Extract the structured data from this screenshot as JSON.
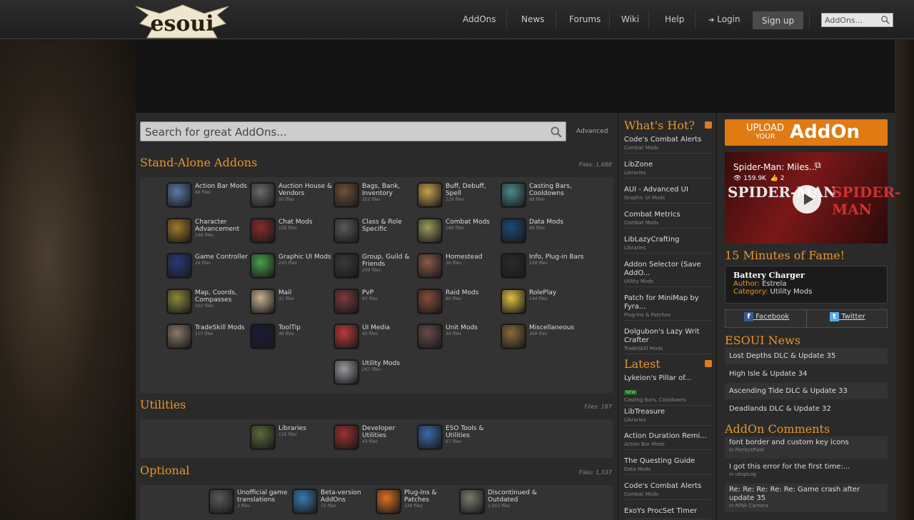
{
  "nav": {
    "logo_text": "esoui",
    "links": [
      "AddOns",
      "News",
      "Forums",
      "Wiki",
      "Help"
    ],
    "login": "Login",
    "signup": "Sign up",
    "search_placeholder": "AddOns..."
  },
  "search": {
    "placeholder": "Search for great AddOns...",
    "advanced": "Advanced"
  },
  "sections": {
    "standalone": {
      "title": "Stand-Alone Addons",
      "files": "Files: 1,688",
      "cats": [
        {
          "name": "Action Bar Mods",
          "count": "66 files",
          "color": "#5a7aa8"
        },
        {
          "name": "Auction House & Vendors",
          "count": "50 files",
          "color": "#6b6b6b"
        },
        {
          "name": "Bags, Bank, Inventory",
          "count": "315 files",
          "color": "#6e5238"
        },
        {
          "name": "Buff, Debuff, Spell",
          "count": "118 files",
          "color": "#c9a24a"
        },
        {
          "name": "Casting Bars, Cooldowns",
          "count": "68 files",
          "color": "#4a8a8a"
        },
        {
          "name": "Character Advancement",
          "count": "146 files",
          "color": "#a07a2a"
        },
        {
          "name": "Chat Mods",
          "count": "128 files",
          "color": "#8a2a2a"
        },
        {
          "name": "Class & Role Specific",
          "count": "",
          "color": "#5a5a5a"
        },
        {
          "name": "Combat Mods",
          "count": "168 files",
          "color": "#9a9a5a"
        },
        {
          "name": "Data Mods",
          "count": "88 files",
          "color": "#1a4a7a"
        },
        {
          "name": "Game Controller",
          "count": "16 files",
          "color": "#2a3a7a"
        },
        {
          "name": "Graphic UI Mods",
          "count": "243 files",
          "color": "#4aa04a"
        },
        {
          "name": "Group, Guild & Friends",
          "count": "209 files",
          "color": "#3a3a3a"
        },
        {
          "name": "Homestead",
          "count": "39 files",
          "color": "#8a5a4a"
        },
        {
          "name": "Info, Plug-in Bars",
          "count": "159 files",
          "color": "#2a2a2a"
        },
        {
          "name": "Map, Coords, Compasses",
          "count": "102 files",
          "color": "#8a8a3a"
        },
        {
          "name": "Mail",
          "count": "31 files",
          "color": "#c8b090"
        },
        {
          "name": "PvP",
          "count": "93 files",
          "color": "#7a3a3a"
        },
        {
          "name": "Raid Mods",
          "count": "80 files",
          "color": "#8a4a3a"
        },
        {
          "name": "RolePlay",
          "count": "144 files",
          "color": "#e0c040"
        },
        {
          "name": "TradeSkill Mods",
          "count": "115 files",
          "color": "#8a7a6a"
        },
        {
          "name": "ToolTip",
          "count": "48 files",
          "color": "#1a1a3a"
        },
        {
          "name": "UI Media",
          "count": "45 files",
          "color": "#c03a3a"
        },
        {
          "name": "Unit Mods",
          "count": "34 files",
          "color": "#6a4a4a"
        },
        {
          "name": "Miscellaneous",
          "count": "309 files",
          "color": "#8a6a3a"
        },
        {
          "name": "Utility Mods",
          "count": "267 files",
          "color": "#9a9aa0"
        }
      ]
    },
    "utilities": {
      "title": "Utilities",
      "files": "Files: 187",
      "cats": [
        {
          "name": "Libraries",
          "count": "116 files",
          "color": "#5a6a3a"
        },
        {
          "name": "Developer Utilities",
          "count": "43 files",
          "color": "#a03030"
        },
        {
          "name": "ESO Tools & Utilities",
          "count": "67 files",
          "color": "#3a6aa8"
        }
      ]
    },
    "optional": {
      "title": "Optional",
      "files": "Files: 1,337",
      "cats": [
        {
          "name": "Unofficial game translations",
          "count": "3 files",
          "color": "#5a5a5a"
        },
        {
          "name": "Beta-version AddOns",
          "count": "71 files",
          "color": "#3a7ab0"
        },
        {
          "name": "Plug-Ins & Patches",
          "count": "339 files",
          "color": "#e07020"
        },
        {
          "name": "Discontinued & Outdated",
          "count": "1,015 files",
          "color": "#7a7a6a"
        }
      ]
    }
  },
  "hot": {
    "title": "What's Hot?",
    "items": [
      {
        "name": "Code's Combat Alerts",
        "cat": "Combat Mods"
      },
      {
        "name": "LibZone",
        "cat": "Libraries"
      },
      {
        "name": "AUI - Advanced UI",
        "cat": "Graphic UI Mods"
      },
      {
        "name": "Combat Metrics",
        "cat": "Combat Mods"
      },
      {
        "name": "LibLazyCrafting",
        "cat": "Libraries"
      },
      {
        "name": "Addon Selector (Save AddO...",
        "cat": "Utility Mods"
      },
      {
        "name": "Patch for MiniMap by Fyra...",
        "cat": "Plug-Ins & Patches"
      },
      {
        "name": "Dolgubon's Lazy Writ Crafter",
        "cat": "TradeSkill Mods"
      }
    ]
  },
  "latest": {
    "title": "Latest",
    "new_badge": "NEW",
    "items": [
      {
        "name": "Lykeion's Pillar of...",
        "cat": "Casting Bars, Cooldowns"
      },
      {
        "name": "LibTreasure",
        "cat": "Libraries"
      },
      {
        "name": "Action Duration Remi...",
        "cat": "Action Bar Mods"
      },
      {
        "name": "The Questing Guide",
        "cat": "Data Mods"
      },
      {
        "name": "Code's Combat Alerts",
        "cat": "Combat Mods"
      },
      {
        "name": "ExoYs ProcSet Timer",
        "cat": ""
      }
    ]
  },
  "upload": {
    "line1": "UPLOAD",
    "line2": "YOUR",
    "line3": "AddOn"
  },
  "video": {
    "title": "Spider-Man: Miles...",
    "views": "159.9K",
    "likes": "2",
    "overlay1": "SPIDER-MAN",
    "overlay2": "SPIDER-MAN"
  },
  "fame": {
    "title": "15 Minutes of Fame!",
    "name": "Battery Charger",
    "author_label": "Author:",
    "author": "Estrela",
    "category_label": "Category:",
    "category": "Utility Mods"
  },
  "social": {
    "facebook": "Facebook",
    "twitter": "Twitter"
  },
  "news": {
    "title": "ESOUI News",
    "items": [
      "Lost Depths DLC & Update 35",
      "High Isle & Update 34",
      "Ascending Tide DLC & Update 33",
      "Deadlands DLC & Update 32"
    ]
  },
  "comments": {
    "title": "AddOn Comments",
    "items": [
      {
        "text": "font border and custom key icons",
        "where": "in PerfectPixel"
      },
      {
        "text": "I got this error for the first time:...",
        "where": "in uespLog"
      },
      {
        "text": "Re: Re: Re: Re: Re: Game crash after update 35",
        "where": "in NTak Camera"
      }
    ]
  }
}
